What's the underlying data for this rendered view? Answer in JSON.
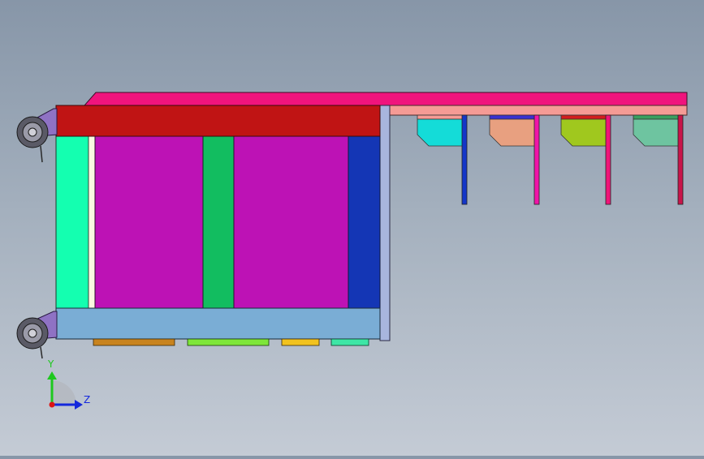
{
  "viewport": {
    "background_top": "#8796a8",
    "background_bottom": "#c4cbd5"
  },
  "model": {
    "parts": [
      {
        "name": "top-rail",
        "color": "#f0147d"
      },
      {
        "name": "tray-rail",
        "color": "#f59b95"
      },
      {
        "name": "cart-top-frame",
        "color": "#c01414"
      },
      {
        "name": "cart-bottom-frame",
        "color": "#7aadd5"
      },
      {
        "name": "side-panel-left",
        "color": "#14ffb0"
      },
      {
        "name": "panel-magenta-1",
        "color": "#bd12b5"
      },
      {
        "name": "panel-magenta-2",
        "color": "#bd12b5"
      },
      {
        "name": "panel-green-divider",
        "color": "#12bd60"
      },
      {
        "name": "panel-blue-right",
        "color": "#1436b5"
      },
      {
        "name": "end-plate",
        "color": "#a8b5dd"
      },
      {
        "name": "caster",
        "color": "#8f72c4"
      },
      {
        "name": "foot-orange",
        "color": "#c8831e"
      },
      {
        "name": "foot-green",
        "color": "#7ee63a"
      },
      {
        "name": "foot-yellow",
        "color": "#f2c21e"
      },
      {
        "name": "foot-teal",
        "color": "#3ee6a6"
      }
    ],
    "trays": [
      {
        "body": "#14dcd8",
        "lid": "#f59b95",
        "post": "#1436c8"
      },
      {
        "body": "#e8a080",
        "lid": "#3a30d0",
        "post": "#f014a8"
      },
      {
        "body": "#a0c81e",
        "lid": "#d21e1e",
        "post": "#f01478"
      },
      {
        "body": "#6ec4a0",
        "lid": "#3aa060",
        "post": "#c8144a"
      }
    ]
  },
  "triad": {
    "y_label": "Y",
    "z_label": "Z",
    "y_color": "#1ec81e",
    "z_color": "#1428dc",
    "x_color": "#dc1414"
  }
}
